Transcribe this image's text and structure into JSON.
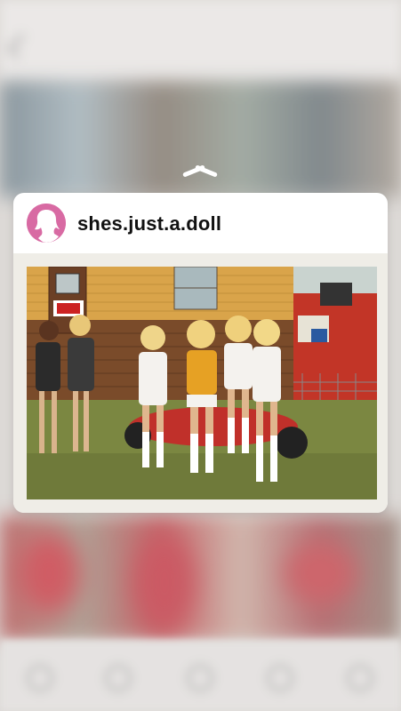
{
  "post": {
    "username": "shes.just.a.doll"
  },
  "icons": {
    "peek_chevron": "chevron-up-icon",
    "avatar": "woman-silhouette-icon"
  },
  "colors": {
    "avatar_bg": "#d86aa3",
    "card_bg": "#ffffff"
  }
}
